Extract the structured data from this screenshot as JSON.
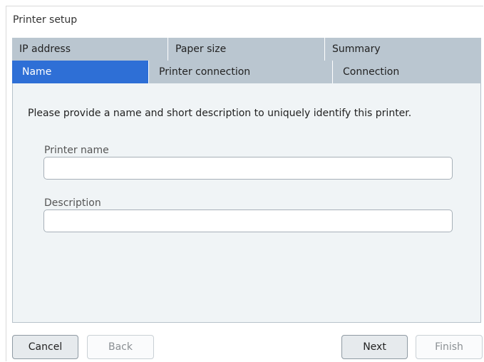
{
  "window": {
    "title": "Printer setup"
  },
  "tabs": {
    "row1": [
      {
        "label": "IP address",
        "active": false
      },
      {
        "label": "Paper size",
        "active": false
      },
      {
        "label": "Summary",
        "active": false
      }
    ],
    "row2": [
      {
        "label": "Name",
        "active": true
      },
      {
        "label": "Printer connection",
        "active": false
      },
      {
        "label": "Connection",
        "active": false
      }
    ]
  },
  "panel": {
    "intro": "Please provide a name and short description to uniquely identify this printer.",
    "fields": [
      {
        "label": "Printer name",
        "value": ""
      },
      {
        "label": "Description",
        "value": ""
      }
    ]
  },
  "buttons": {
    "cancel": {
      "label": "Cancel",
      "enabled": true
    },
    "back": {
      "label": "Back",
      "enabled": false
    },
    "next": {
      "label": "Next",
      "enabled": true
    },
    "finish": {
      "label": "Finish",
      "enabled": false
    }
  },
  "colors": {
    "active_tab": "#2e6fd6",
    "inactive_tab": "#bac6d0",
    "panel_bg": "#f0f4f6"
  }
}
